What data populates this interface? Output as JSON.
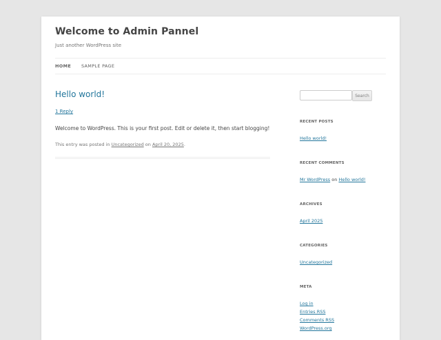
{
  "site": {
    "title": "Welcome to Admin Pannel",
    "description": "Just another WordPress site"
  },
  "nav": {
    "items": [
      {
        "label": "HOME",
        "current": true
      },
      {
        "label": "SAMPLE PAGE",
        "current": false
      }
    ]
  },
  "post": {
    "title": "Hello world!",
    "reply_link": "1 Reply",
    "content": "Welcome to WordPress. This is your first post. Edit or delete it, then start blogging!",
    "meta": {
      "prefix": "This entry was posted in",
      "category": "Uncategorized",
      "on": "on",
      "date": "April 20, 2025",
      "suffix": "."
    }
  },
  "sidebar": {
    "search": {
      "value": "",
      "button_label": "Search"
    },
    "recent_posts": {
      "title": "RECENT POSTS",
      "items": [
        "Hello world!"
      ]
    },
    "recent_comments": {
      "title": "RECENT COMMENTS",
      "author": "Mr WordPress",
      "on": "on",
      "post": "Hello world!"
    },
    "archives": {
      "title": "ARCHIVES",
      "items": [
        "April 2025"
      ]
    },
    "categories": {
      "title": "CATEGORIES",
      "items": [
        "Uncategorized"
      ]
    },
    "meta": {
      "title": "META",
      "items": [
        "Log in",
        "Entries RSS",
        "Comments RSS",
        "WordPress.org"
      ]
    }
  },
  "colors": {
    "link": "#21759b",
    "background": "#e6e6e6",
    "page": "#ffffff"
  }
}
